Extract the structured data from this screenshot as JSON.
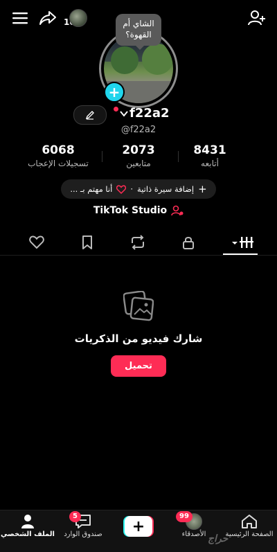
{
  "top": {
    "views_count": "10"
  },
  "profile": {
    "note_bubble": "الشاي أم القهوة؟",
    "username": "f22a2",
    "handle": "@f22a2",
    "add_button": "+"
  },
  "stats": [
    {
      "value": "8431",
      "label": "أتابعه"
    },
    {
      "value": "2073",
      "label": "متابعين"
    },
    {
      "value": "6068",
      "label": "تسجيلات الإعجاب"
    }
  ],
  "bio": {
    "add_bio": "إضافة سيرة ذاتية",
    "sep": "·",
    "interest": "أنا مهتم بـ ..."
  },
  "studio": {
    "label": "TikTok Studio"
  },
  "empty_state": {
    "title": "شارك فيديو من الذكريات",
    "button": "تحميل"
  },
  "bottom_nav": {
    "home": "الصفحة الرئيسية",
    "friends": "الأصدقاء",
    "friends_badge": "99",
    "create": "+",
    "inbox": "صندوق الوارد",
    "inbox_badge": "5",
    "profile": "الملف الشخصي"
  },
  "colors": {
    "accent": "#fe2c55",
    "cyan": "#20d5ec"
  },
  "watermark": "حراج"
}
